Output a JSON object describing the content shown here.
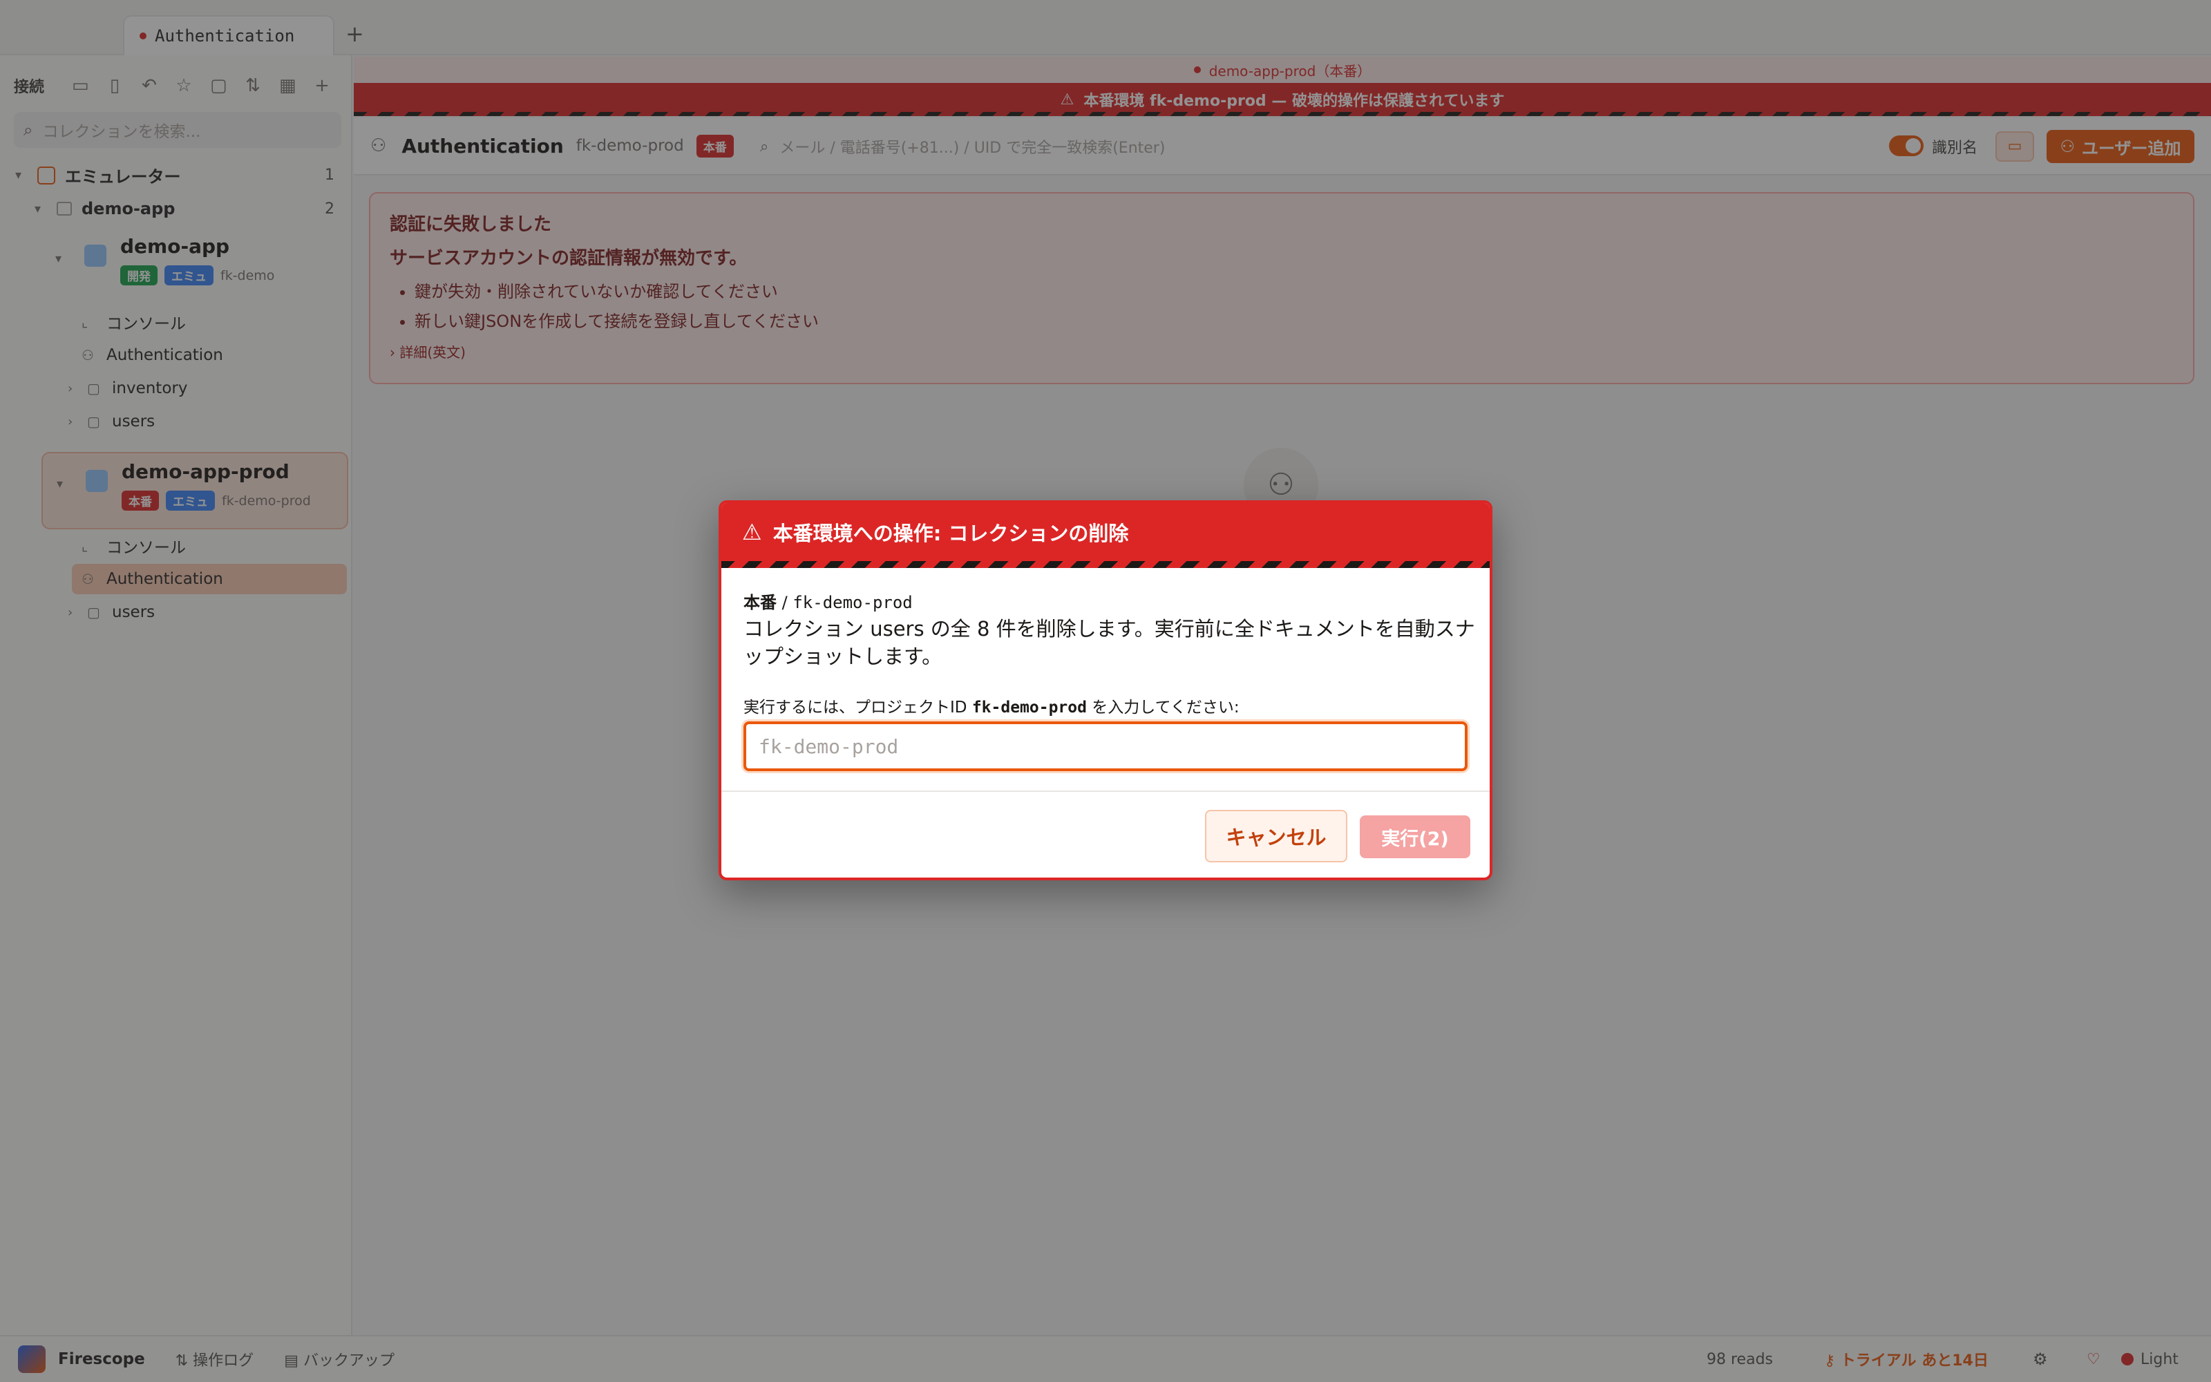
{
  "tabs": [
    {
      "label": "Authentication"
    }
  ],
  "sidebar": {
    "toolbar_label": "接続",
    "search_placeholder": "コレクションを検索...",
    "emulator": {
      "label": "エミュレーター",
      "count": "1"
    },
    "group": {
      "label": "demo-app",
      "count": "2"
    },
    "projects": [
      {
        "name": "demo-app",
        "badges": [
          "開発",
          "エミュ"
        ],
        "project_id": "fk-demo",
        "items": [
          "コンソール",
          "Authentication",
          "inventory",
          "users"
        ]
      },
      {
        "name": "demo-app-prod",
        "badges": [
          "本番",
          "エミュ"
        ],
        "project_id": "fk-demo-prod",
        "items": [
          "コンソール",
          "Authentication",
          "users"
        ]
      }
    ]
  },
  "main": {
    "env_strip": "demo-app-prod（本番）",
    "warning_bar": "本番環境 fk-demo-prod — 破壊的操作は保護されています",
    "header": {
      "title": "Authentication",
      "project_id": "fk-demo-prod",
      "badge": "本番",
      "search_placeholder": "メール / 電話番号(+81...) / UID で完全一致検索(Enter)",
      "toggle_label": "識別名",
      "add_user_label": "ユーザー追加"
    },
    "error": {
      "title": "認証に失敗しました",
      "message": "サービスアカウントの認証情報が無効です。",
      "items": [
        "鍵が失効・削除されていないか確認してください",
        "新しい鍵JSONを作成して接続を登録し直してください"
      ],
      "details_label": "詳細(英文)"
    }
  },
  "statusbar": {
    "app_name": "Firescope",
    "ops_log": "操作ログ",
    "backup": "バックアップ",
    "reads": "98 reads",
    "trial": "トライアル あと14日",
    "theme": "Light"
  },
  "modal": {
    "title": "本番環境への操作: コレクションの削除",
    "env_label": "本番",
    "env_separator": " / ",
    "env_project": "fk-demo-prod",
    "description": "コレクション users の全 8 件を削除します。実行前に全ドキュメントを自動スナップショットします。",
    "prompt_prefix": "実行するには、プロジェクトID ",
    "prompt_project_id": "fk-demo-prod",
    "prompt_suffix": " を入力してください:",
    "input_value": "",
    "input_placeholder": "fk-demo-prod",
    "cancel_label": "キャンセル",
    "execute_label": "実行(2)"
  }
}
